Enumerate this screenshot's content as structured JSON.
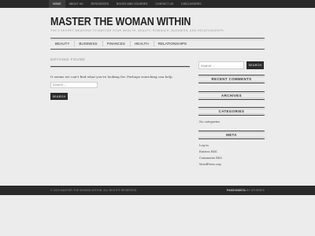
{
  "top_nav": {
    "items": [
      {
        "label": "Home",
        "active": true
      },
      {
        "label": "About Us"
      },
      {
        "label": "Resources"
      },
      {
        "label": "Books and Courses"
      },
      {
        "label": "Contact Us"
      },
      {
        "label": "Disclosures"
      }
    ]
  },
  "header": {
    "title": "MASTER THE WOMAN WITHIN",
    "description": "THE 5 SECRET WEAPONS TO MASTER YOUR WEALTH, BEAUTY, ROMANCE, BUSINESS, AND RELATIONSHIPS"
  },
  "main_menu": {
    "items": [
      "Beauty",
      "Business",
      "Finances",
      "Health",
      "Relationships"
    ]
  },
  "content": {
    "title": "NOTHING FOUND",
    "message": "It seems we can't find what you're looking for. Perhaps searching can help.",
    "search_placeholder": "Search ...",
    "search_button": "SEARCH"
  },
  "sidebar": {
    "search_placeholder": "Search ...",
    "search_button": "SEARCH",
    "recent_comments_title": "RECENT COMMENTS",
    "archives_title": "ARCHIVES",
    "categories_title": "CATEGORIES",
    "categories_empty": "No categories",
    "meta_title": "META",
    "meta_links": [
      "Log in",
      "Entries RSS",
      "Comments RSS",
      "WordPress.org"
    ]
  },
  "footer": {
    "copyright": "© 2019 MASTER THE WOMAN WITHIN. ALL RIGHTS RESERVED.",
    "theme_name": "PASSIONISTA",
    "theme_by": "BY ATHEMES"
  }
}
